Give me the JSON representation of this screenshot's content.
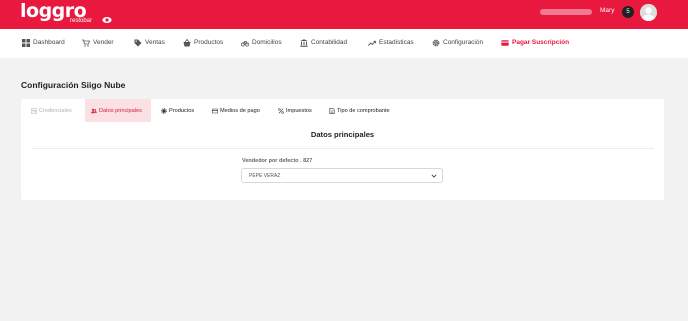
{
  "header": {
    "logo_text": "loggro",
    "logo_subtext": "restobar",
    "account_text_blurred": "",
    "user_name": "Mary",
    "notification_count": "5"
  },
  "nav": {
    "items": [
      {
        "label": "Dashboard",
        "icon": "dashboard-icon"
      },
      {
        "label": "Vender",
        "icon": "cart-icon"
      },
      {
        "label": "Ventas",
        "icon": "tag-icon"
      },
      {
        "label": "Productos",
        "icon": "basket-icon"
      },
      {
        "label": "Domicilios",
        "icon": "bicycle-icon"
      },
      {
        "label": "Contabilidad",
        "icon": "bank-icon"
      },
      {
        "label": "Estadisticas",
        "icon": "trend-icon"
      },
      {
        "label": "Configuración",
        "icon": "gear-icon"
      },
      {
        "label": "Pagar Suscripción",
        "icon": "credit-card-icon"
      }
    ]
  },
  "page": {
    "title": "Configuración Siigo Nube"
  },
  "tabs": [
    {
      "label": "Credenciales",
      "icon": "id-card-icon",
      "state": "disabled"
    },
    {
      "label": "Datos principales",
      "icon": "users-icon",
      "state": "active"
    },
    {
      "label": "Productos",
      "icon": "gear-icon",
      "state": "normal"
    },
    {
      "label": "Medios de pago",
      "icon": "credit-card-icon",
      "state": "normal"
    },
    {
      "label": "Impuestos",
      "icon": "percent-icon",
      "state": "normal"
    },
    {
      "label": "Tipo de comprobante",
      "icon": "document-icon",
      "state": "normal"
    }
  ],
  "section": {
    "title": "Datos principales",
    "field_label": "Vendedor por defecto . 827",
    "select_value": "PEPE VERAZ"
  },
  "colors": {
    "brand": "#e8183f",
    "active_tab_bg": "#fbe1e4",
    "background": "#f2f2f3"
  }
}
